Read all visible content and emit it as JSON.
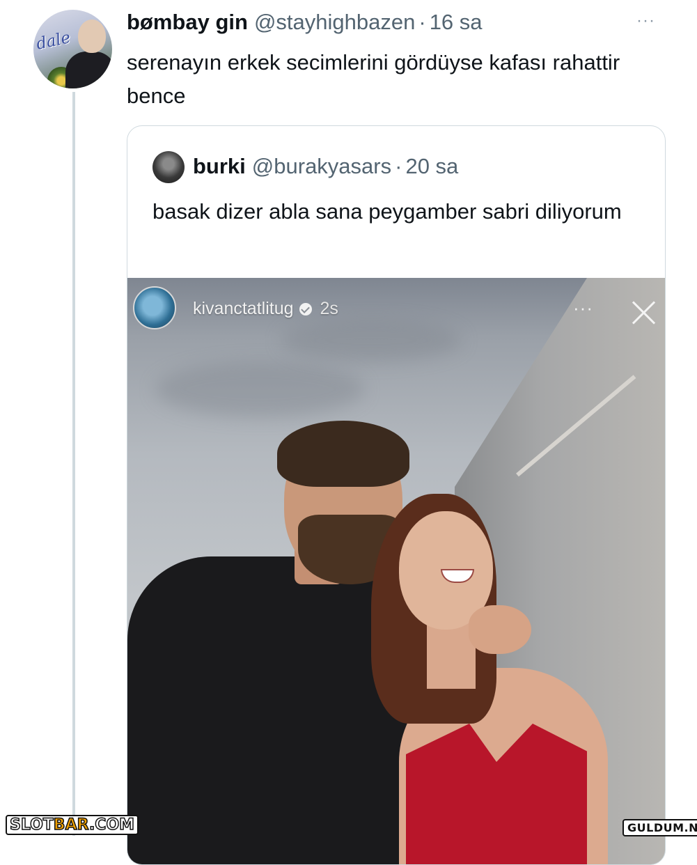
{
  "tweet": {
    "display_name": "bømbay gin",
    "handle": "@stayhighbazen",
    "separator": "·",
    "time": "16 sa",
    "more_icon": "···",
    "text": "serenayın erkek secimlerini gördüyse kafası rahattir bence",
    "avatar_text": "dale"
  },
  "quote": {
    "display_name": "burki",
    "handle": "@burakyasars",
    "separator": "·",
    "time": "20 sa",
    "text": "basak dizer abla sana peygamber sabri diliyorum"
  },
  "story": {
    "username": "kivanctatlitug",
    "age": "2s",
    "more_icon": "···"
  },
  "watermarks": {
    "left_part1": "SLOT",
    "left_accent": "BAR",
    "left_part2": ".COM",
    "right": "GULDUM.NET"
  },
  "colors": {
    "text": "#0f1419",
    "secondary": "#536471",
    "border": "#cfd9de",
    "dress": "#b8162a"
  }
}
